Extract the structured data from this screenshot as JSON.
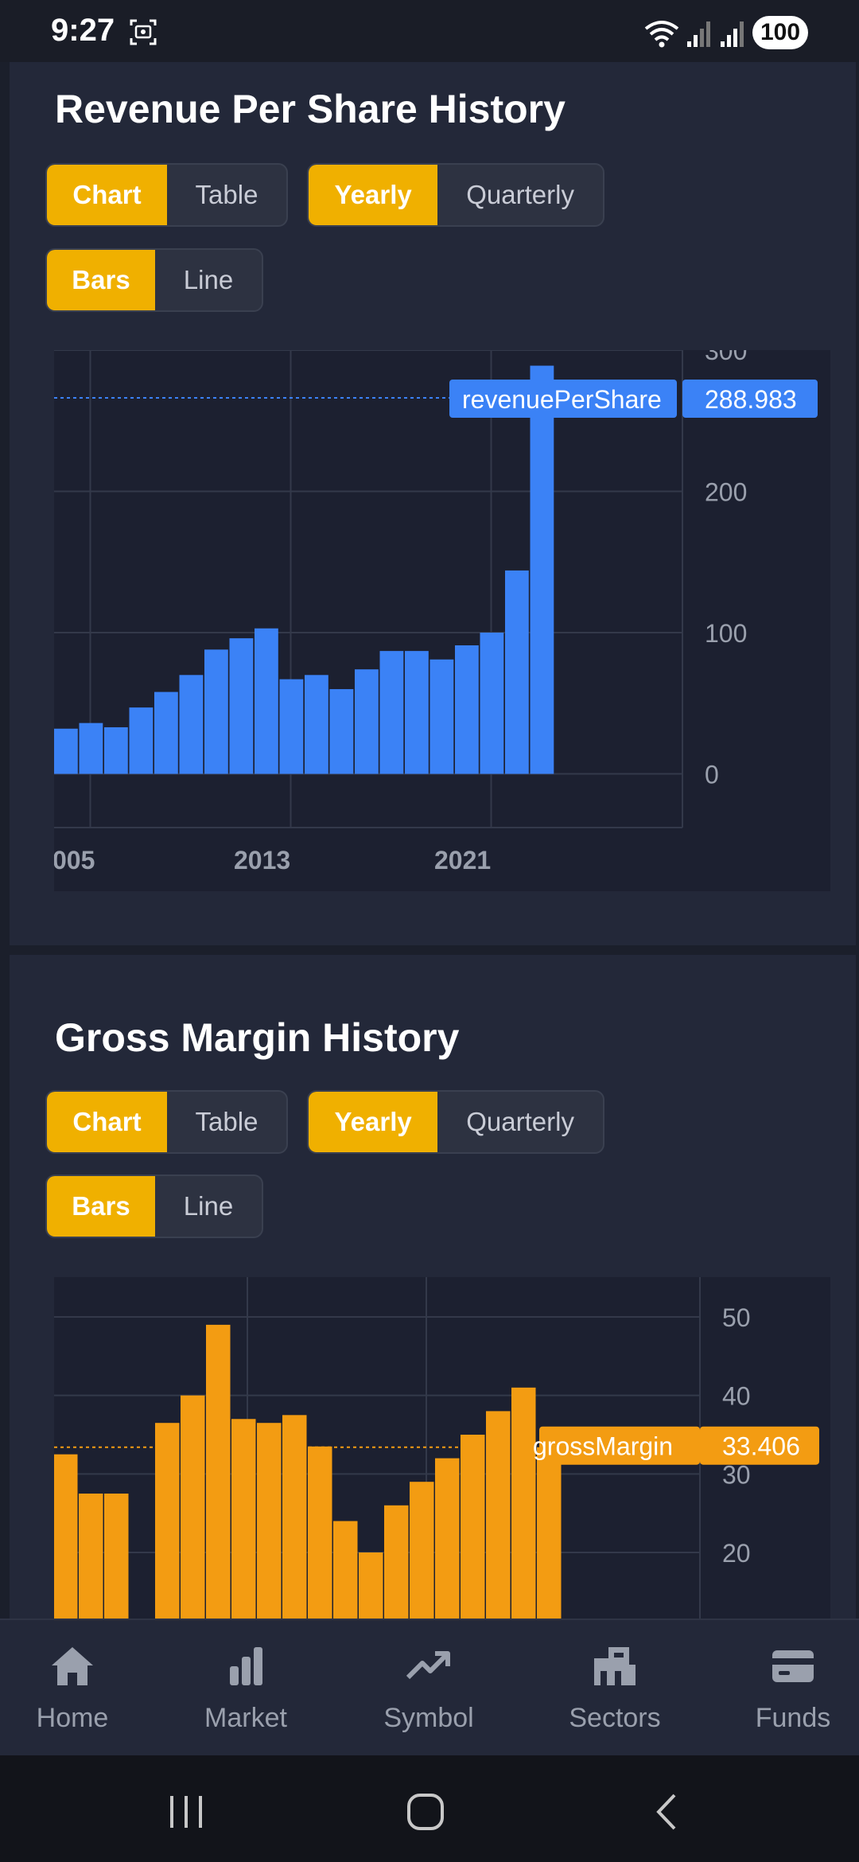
{
  "status": {
    "time": "9:27",
    "battery": "100"
  },
  "sections": [
    {
      "title": "Revenue Per Share History",
      "toggles": {
        "chart": "Chart",
        "table": "Table",
        "yearly": "Yearly",
        "quarterly": "Quarterly",
        "bars": "Bars",
        "line": "Line"
      }
    },
    {
      "title": "Gross Margin History",
      "toggles": {
        "chart": "Chart",
        "table": "Table",
        "yearly": "Yearly",
        "quarterly": "Quarterly",
        "bars": "Bars",
        "line": "Line"
      }
    }
  ],
  "chart_data": [
    {
      "type": "bar",
      "series": [
        {
          "name": "revenuePerShare",
          "values": [
            32,
            36,
            33,
            47,
            58,
            70,
            88,
            96,
            103,
            67,
            70,
            60,
            74,
            87,
            87,
            81,
            91,
            100,
            144,
            288.983
          ]
        }
      ],
      "x": [
        2004,
        2005,
        2006,
        2007,
        2008,
        2009,
        2010,
        2011,
        2012,
        2013,
        2014,
        2015,
        2016,
        2017,
        2018,
        2019,
        2020,
        2021,
        2022,
        2023
      ],
      "x_tick_labels": [
        "005",
        "2013",
        "2021"
      ],
      "y_ticks": [
        "0",
        "100",
        "200",
        "300"
      ],
      "ylim": [
        -38,
        300
      ],
      "color": "#3b82f6",
      "crosshair": {
        "label": "revenuePerShare",
        "value": "288.983"
      }
    },
    {
      "type": "bar",
      "series": [
        {
          "name": "grossMargin",
          "values": [
            32.5,
            27.5,
            27.5,
            null,
            36.5,
            40,
            49,
            37,
            36.5,
            37.5,
            33.5,
            24,
            20,
            26,
            29,
            32,
            35,
            38,
            41,
            33.406
          ]
        }
      ],
      "y_ticks": [
        "20",
        "30",
        "40",
        "50"
      ],
      "ylim": [
        11,
        55
      ],
      "color": "#f39c12",
      "crosshair": {
        "label": "grossMargin",
        "value": "33.406"
      }
    }
  ],
  "nav": [
    {
      "label": "Home",
      "icon": "home-icon"
    },
    {
      "label": "Market",
      "icon": "bar-chart-icon"
    },
    {
      "label": "Symbol",
      "icon": "trending-up-icon"
    },
    {
      "label": "Sectors",
      "icon": "building-icon"
    },
    {
      "label": "Funds",
      "icon": "wallet-icon"
    }
  ]
}
